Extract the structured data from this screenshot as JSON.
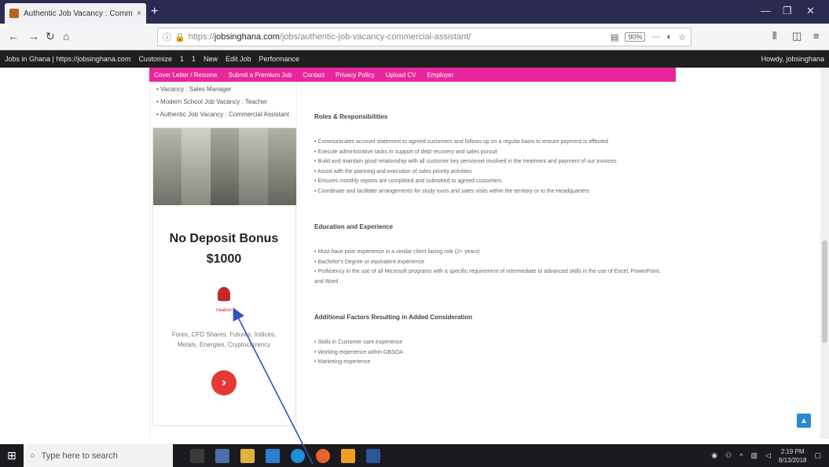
{
  "browser": {
    "tab_title": "Authentic Job Vacancy : Comm",
    "tab_close": "×",
    "newtab_label": "+",
    "url": {
      "prefix": "https://",
      "domain": "jobsinghana.com",
      "path": "/jobs/authentic-job-vacancy-commercial-assistant/"
    },
    "zoom": "90%",
    "menu_dots": "···"
  },
  "bookmarks": [
    "Jobs in Ghana | https://jobsinghana.com",
    "Customize",
    "1",
    "1",
    "New",
    "Edit Job",
    "Performance"
  ],
  "bookmarks_right": "Howdy, jobsinghana",
  "pinknav": [
    "Cover Letter / Resume",
    "Submit a Premium Job",
    "Contact",
    "Privacy Policy",
    "Upload CV",
    "Employer"
  ],
  "sidebar_links": [
    "Vacancy : Sales Manager",
    "Modern School Job Vacancy : Teacher",
    "Authentic Job Vacancy : Commercial Assistant"
  ],
  "ad": {
    "title_line1": "No Deposit Bonus",
    "title_line2": "$1000",
    "brand": "naaboo",
    "desc": "Forex, CFD Shares, Futures, Indices, Metals, Energies, Cryptocurrency",
    "cta": "›"
  },
  "sections": [
    {
      "heading": "Roles & Responsibilities",
      "items": [
        "Communicates account statement to agreed customers and follows up on a regular basis to ensure payment is effected",
        "Execute administrative tasks in support of debt recovery and sales pursuit",
        "Build and maintain good relationship with all customer key personnel involved in the treatment and payment of our invoices",
        "Assist with the planning and execution of sales priority activities",
        "Ensures monthly reports are completed and submitted to agreed customers",
        "Coordinate and facilitate arrangements for study tours and sales visits within the territory or to the Headquarters"
      ]
    },
    {
      "heading": "Education and Experience",
      "items": [
        "Must have prior experience in a similar client facing role (2+ years)",
        "Bachelor's Degree or equivalent experience",
        "Proficiency in the use of all Microsoft programs with a specific requirement of intermediate to advanced skills in the use of Excel, PowerPoint, and Word"
      ]
    },
    {
      "heading": "Additional Factors Resulting in Added Consideration",
      "items": [
        "Skills in Customer care experience",
        "Working experience within GBSOA",
        "Marketing experience"
      ]
    }
  ],
  "taskbar": {
    "search_placeholder": "Type here to search",
    "time": "2:19 PM",
    "date": "8/13/2018"
  },
  "colors": {
    "pink_nav": "#e8279c",
    "titlebar": "#2b2b52",
    "cta": "#e53935",
    "annotation_arrow": "#3050c8"
  }
}
